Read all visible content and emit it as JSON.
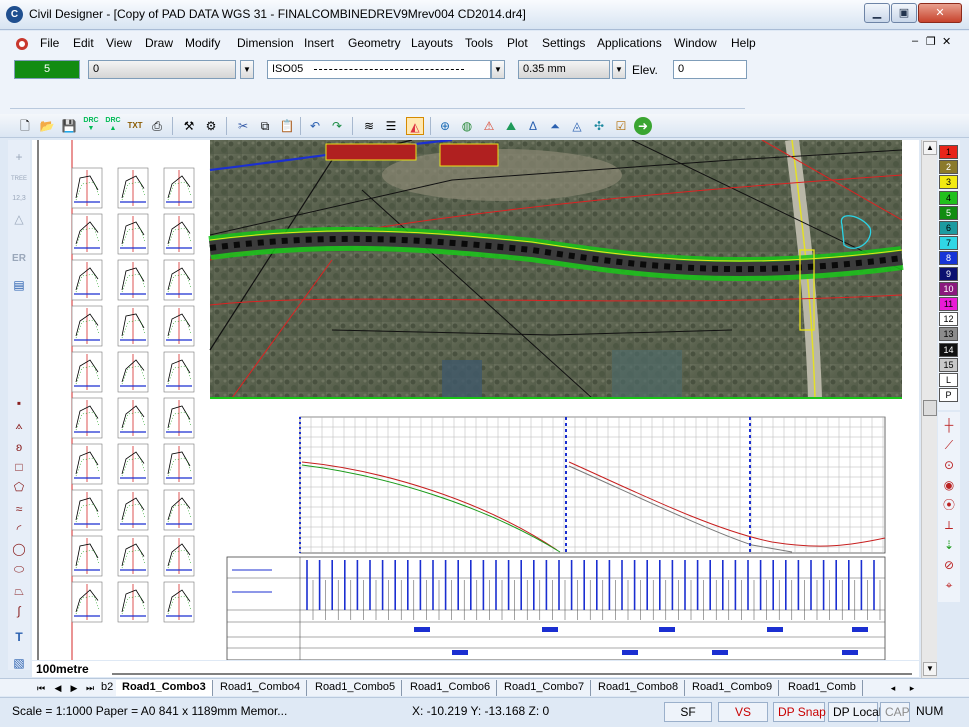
{
  "window": {
    "app_icon": "civil-designer-logo-icon",
    "title": "Civil Designer - [Copy of PAD DATA WGS 31 - FINALCOMBINEDREV9Mrev004 CD2014.dr4]",
    "minimize": "▁",
    "maximize": "▣",
    "close": "✕"
  },
  "menu": {
    "items": [
      "File",
      "Edit",
      "View",
      "Draw",
      "Modify",
      "Dimension",
      "Insert",
      "Geometry",
      "Layouts",
      "Tools",
      "Plot",
      "Settings",
      "Applications",
      "Window",
      "Help"
    ],
    "mdi_minimize": "‒",
    "mdi_restore": "❐",
    "mdi_close": "✕"
  },
  "properties": {
    "color_value": "5",
    "color_hex": "#128c12",
    "layer_value": "0",
    "linetype_value": "ISO05",
    "lineweight_value": "0.35 mm",
    "elev_label": "Elev.",
    "elev_value": "0"
  },
  "toolbar": {
    "icons": [
      "new-file-icon",
      "open-folder-icon",
      "save-icon",
      "drc-import-icon",
      "drc-export-icon",
      "txt-export-icon",
      "print-icon",
      "tools-icon",
      "settings-icon",
      "cut-icon",
      "copy-icon",
      "paste-icon",
      "undo-icon",
      "redo-icon",
      "layers-icon",
      "properties-icon",
      "snap-icon",
      "zoom-icon",
      "render-icon",
      "triangle-icon",
      "terrain-icon",
      "delta-icon",
      "apex-icon",
      "grade-icon",
      "network-icon",
      "checklist-icon",
      "go-icon"
    ]
  },
  "left_palette": {
    "icons": [
      "plus-icon",
      "tree-icon",
      "numbers-icon",
      "triangle-icon",
      "er-icon",
      "layer-icon",
      "point-icon",
      "polyline-icon",
      "spline-icon",
      "rectangle-icon",
      "polygon-icon",
      "multiline-icon",
      "arc-icon",
      "circle-icon",
      "ellipse-icon",
      "trapezoid-icon",
      "curve-icon",
      "text-icon",
      "hatch-icon",
      "cloud-icon"
    ],
    "labels": {
      "tree": "TREE",
      "numbers": "12,3",
      "er": "ER"
    }
  },
  "color_palette": {
    "swatches": [
      {
        "label": "1",
        "color": "#e8251a"
      },
      {
        "label": "2",
        "color": "#8b7a2b"
      },
      {
        "label": "3",
        "color": "#f2ea12"
      },
      {
        "label": "4",
        "color": "#21c11d"
      },
      {
        "label": "5",
        "color": "#128c12"
      },
      {
        "label": "6",
        "color": "#1d9ba0"
      },
      {
        "label": "7",
        "color": "#30d7e6"
      },
      {
        "label": "8",
        "color": "#1734d6"
      },
      {
        "label": "9",
        "color": "#0c1070"
      },
      {
        "label": "10",
        "color": "#8a1a7e"
      },
      {
        "label": "11",
        "color": "#e91bd6"
      },
      {
        "label": "12",
        "color": "#ffffff"
      },
      {
        "label": "13",
        "color": "#8c8c8c"
      },
      {
        "label": "14",
        "color": "#111111"
      },
      {
        "label": "15",
        "color": "#c8c8c8"
      },
      {
        "label": "L",
        "color": "#ffffff"
      },
      {
        "label": "P",
        "color": "#ffffff"
      }
    ]
  },
  "right_palette": {
    "icons": [
      "snap-endpoint-icon",
      "snap-midpoint-icon",
      "snap-center-icon",
      "snap-intersection-icon",
      "snap-perpendicular-icon",
      "snap-tangent-icon",
      "snap-nearest-icon",
      "snap-quadrant-icon",
      "snap-clear-icon",
      "snap-node-icon"
    ]
  },
  "canvas": {
    "scale_label": "100metre"
  },
  "tabs": {
    "items": [
      "b2",
      "Road1_Combo3",
      "Road1_Combo4",
      "Road1_Combo5",
      "Road1_Combo6",
      "Road1_Combo7",
      "Road1_Combo8",
      "Road1_Combo9",
      "Road1_Comb"
    ],
    "active_index": 1
  },
  "status": {
    "scale_paper": "Scale = 1:1000  Paper = A0 841 x 1189mm  Memor...",
    "coords": "X: -10.219 Y: -13.168 Z: 0",
    "sf": "SF",
    "vs": "VS",
    "dp_snap": "DP Snap",
    "dp_local": "DP Local",
    "cap": "CAP",
    "num": "NUM"
  }
}
